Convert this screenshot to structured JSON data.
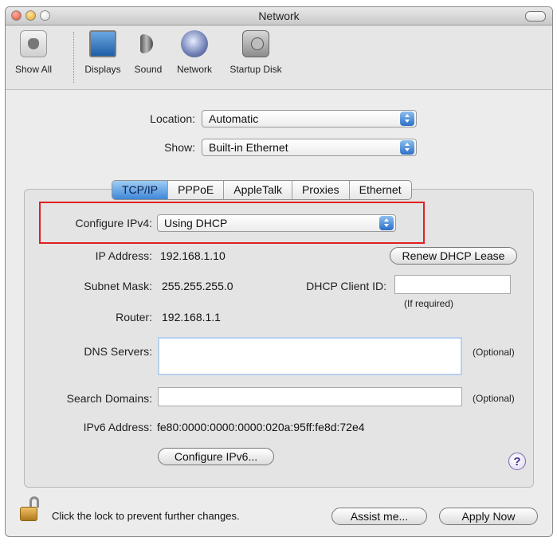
{
  "window": {
    "title": "Network"
  },
  "toolbar": {
    "items": [
      {
        "label": "Show All",
        "icon": "show-all-icon"
      },
      {
        "label": "Displays",
        "icon": "displays-icon"
      },
      {
        "label": "Sound",
        "icon": "sound-icon"
      },
      {
        "label": "Network",
        "icon": "network-icon"
      },
      {
        "label": "Startup Disk",
        "icon": "startup-disk-icon"
      }
    ]
  },
  "location": {
    "label": "Location:",
    "value": "Automatic"
  },
  "show": {
    "label": "Show:",
    "value": "Built-in Ethernet"
  },
  "tabs": [
    "TCP/IP",
    "PPPoE",
    "AppleTalk",
    "Proxies",
    "Ethernet"
  ],
  "active_tab": "TCP/IP",
  "tcpip": {
    "configure_label": "Configure IPv4:",
    "configure_value": "Using DHCP",
    "ip_label": "IP Address:",
    "ip_value": "192.168.1.10",
    "renew_button": "Renew DHCP Lease",
    "subnet_label": "Subnet Mask:",
    "subnet_value": "255.255.255.0",
    "client_id_label": "DHCP Client ID:",
    "client_id_value": "",
    "client_id_hint": "(If required)",
    "router_label": "Router:",
    "router_value": "192.168.1.1",
    "dns_label": "DNS Servers:",
    "dns_value": "",
    "dns_hint": "(Optional)",
    "search_label": "Search Domains:",
    "search_value": "",
    "search_hint": "(Optional)",
    "ipv6_label": "IPv6 Address:",
    "ipv6_value": "fe80:0000:0000:0000:020a:95ff:fe8d:72e4",
    "configure_ipv6_button": "Configure IPv6...",
    "help_glyph": "?"
  },
  "footer": {
    "lock_text": "Click the lock to prevent further changes.",
    "assist_button": "Assist me...",
    "apply_button": "Apply Now"
  },
  "colors": {
    "highlight_box": "#e02020",
    "accent": "#3f87d7"
  }
}
